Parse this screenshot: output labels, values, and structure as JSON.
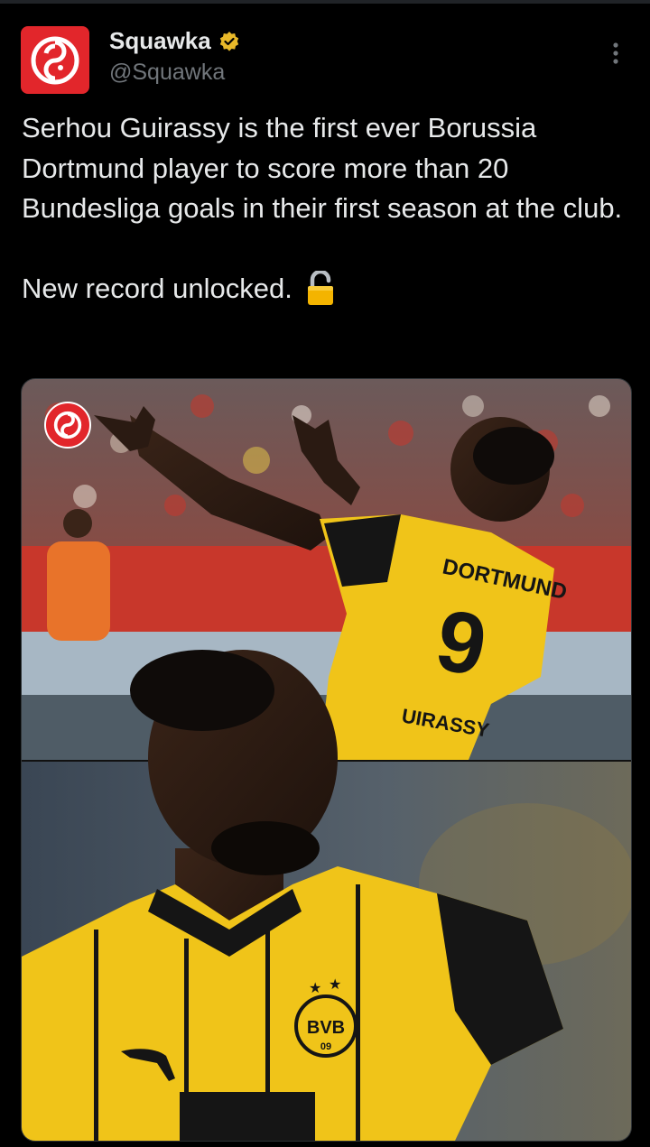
{
  "post": {
    "author": {
      "display_name": "Squawka",
      "handle": "@Squawka",
      "verified_badge": "gold-verified-badge-icon",
      "avatar_icon": "squawka-logo-icon",
      "avatar_color": "#e2262b"
    },
    "more_icon": "more-vertical-icon",
    "text_paragraph_1": "Serhou Guirassy is the first ever Borussia Dortmund player to score more than 20 Bundesliga goals in their first season at the club.",
    "text_paragraph_2": "New record unlocked.",
    "text_emoji": "unlocked-padlock-icon",
    "media": {
      "jersey_top": {
        "team_text": "DORTMUND",
        "number": "9",
        "name_text": "UIRASSY"
      },
      "jersey_bottom": {
        "crest_text": "BVB",
        "crest_year": "09"
      },
      "watermark_icon": "squawka-logo-icon",
      "colors": {
        "kit_yellow": "#f0c419",
        "kit_black": "#151515",
        "stadium_red": "#c8372b"
      }
    }
  }
}
